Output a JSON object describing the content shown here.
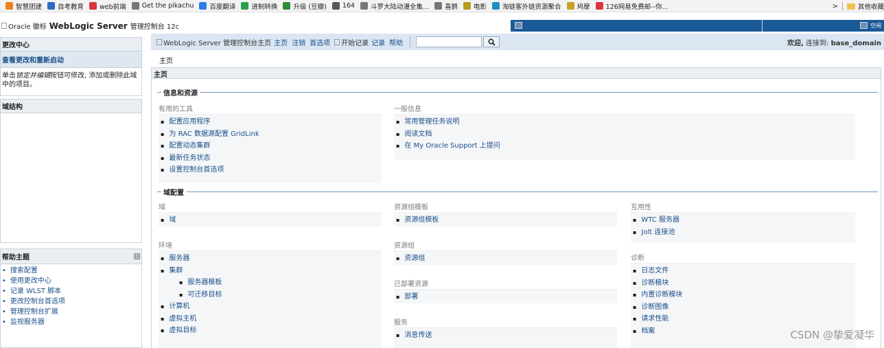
{
  "bookmarks": {
    "items": [
      {
        "label": "智慧团建",
        "color": "#e8811a"
      },
      {
        "label": "自考教育",
        "color": "#2b6cc4"
      },
      {
        "label": "web前端",
        "color": "#d9363e"
      },
      {
        "label": "Get the pikachu",
        "color": "#777777"
      },
      {
        "label": "百度翻译",
        "color": "#2b7de9"
      },
      {
        "label": "进制转换",
        "color": "#2aa04a"
      },
      {
        "label": "升级 (豆瓣)",
        "color": "#2e8b3a"
      },
      {
        "label": "164",
        "color": "#555555"
      },
      {
        "label": "斗罗大陆动漫全集...",
        "color": "#777777"
      },
      {
        "label": "喜鹊",
        "color": "#777777"
      },
      {
        "label": "电影",
        "color": "#b89a1e"
      },
      {
        "label": "淘链客外链资源聚合",
        "color": "#1f8fbf"
      },
      {
        "label": "鸠摩",
        "color": "#c9a227"
      },
      {
        "label": "126网易免费邮--你...",
        "color": "#d9363e"
      }
    ],
    "chevron": ">",
    "folder_label": "其他收藏"
  },
  "titlebar": {
    "logo_alt": "Oracle 徽标",
    "product": "WebLogic Server",
    "console": "管理控制台 12c",
    "idle_alt": "空闲"
  },
  "change_center": {
    "title": "更改中心",
    "link": "查看更改和重新启动",
    "desc_prefix": "单击",
    "desc_em": "锁定并编辑",
    "desc_suffix": "按钮可修改, 添加或删除此域中的项目。"
  },
  "domain_structure": {
    "title": "域结构"
  },
  "help_topics": {
    "title": "帮助主题",
    "collapse": "⊟",
    "items": [
      "搜索配置",
      "使用更改中心",
      "记录 WLST 脚本",
      "更改控制台首选项",
      "管理控制台扩展",
      "监视服务器"
    ]
  },
  "toolbar": {
    "home_logo_alt": "WebLogic Server 管理控制台主页",
    "home": "主页",
    "logout": "注销",
    "preferences": "首选项",
    "record_logo_alt": "开始记录",
    "record": "记录",
    "help": "帮助",
    "search_value": "",
    "welcome": "欢迎,",
    "connected_to": "连接到:",
    "domain": "base_domain"
  },
  "breadcrumb": "主页",
  "main": {
    "title": "主页",
    "sections": {
      "info": "信息和资源",
      "domain_config": "域配置"
    },
    "useful_tools": {
      "title": "有用的工具",
      "items": [
        "配置应用程序",
        "为 RAC 数据源配置 GridLink",
        "配置动态集群",
        "最新任务状态",
        "设置控制台首选项"
      ]
    },
    "general_info": {
      "title": "一般信息",
      "items": [
        "常用管理任务说明",
        "阅读文档",
        "在 My Oracle Support 上提问"
      ]
    },
    "domain": {
      "title": "域",
      "items": [
        "域"
      ]
    },
    "environment": {
      "title": "环境",
      "items": [
        "服务器",
        "集群"
      ],
      "sub_items": [
        "服务器模板",
        "可迁移目标"
      ],
      "items_after": [
        "计算机",
        "虚拟主机",
        "虚拟目标"
      ]
    },
    "resource_group_templates": {
      "title": "资源组模板",
      "items": [
        "资源组模板"
      ]
    },
    "resource_groups": {
      "title": "资源组",
      "items": [
        "资源组"
      ]
    },
    "deployed_resources": {
      "title": "已部署资源",
      "items": [
        "部署"
      ]
    },
    "services": {
      "title": "服务",
      "items": [
        "消息传送"
      ]
    },
    "interoperability": {
      "title": "互用性",
      "items": [
        "WTC 服务器",
        "Jolt 连接池"
      ]
    },
    "diagnostics": {
      "title": "诊断",
      "items": [
        "日志文件",
        "诊断模块",
        "内置诊断模块",
        "诊断图像",
        "请求性能",
        "档案"
      ]
    }
  },
  "watermark": "CSDN @挚爱凝华"
}
